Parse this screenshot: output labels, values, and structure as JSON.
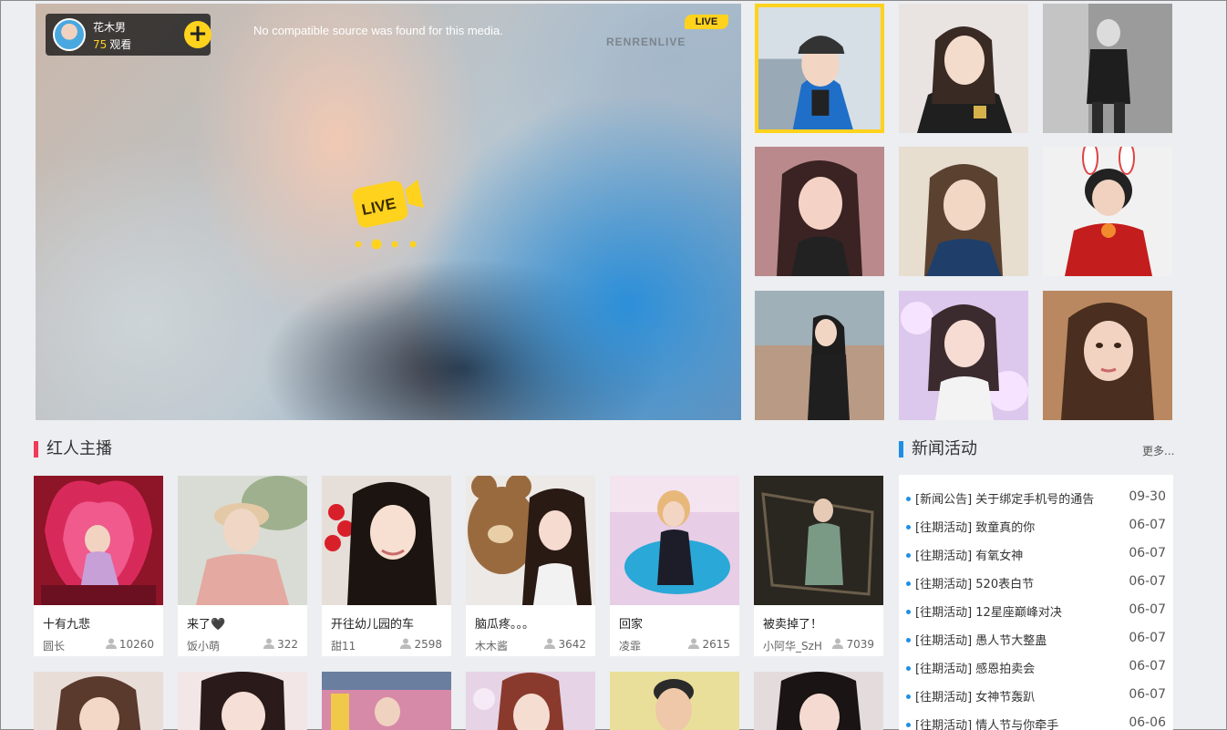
{
  "player": {
    "anchor_name": "花木男",
    "viewer_count": "75",
    "viewer_label": "观看",
    "follow_label": "+",
    "message": "No compatible source was found for this media.",
    "live_tag": "LIVE",
    "watermark": "RENRENLIVE",
    "badge_text": "LIVE"
  },
  "thumbs": [
    {
      "name": "featured-1",
      "active": true
    },
    {
      "name": "featured-2"
    },
    {
      "name": "featured-3"
    },
    {
      "name": "featured-4"
    },
    {
      "name": "featured-5"
    },
    {
      "name": "featured-6"
    },
    {
      "name": "featured-7"
    },
    {
      "name": "featured-8"
    },
    {
      "name": "featured-9"
    }
  ],
  "hot": {
    "title": "红人主播",
    "cards": [
      {
        "title": "十有九悲",
        "nick": "圆长",
        "count": "10260"
      },
      {
        "title": "来了🖤",
        "nick": "饭小萌",
        "count": "322"
      },
      {
        "title": "开往幼儿园的车",
        "nick": "甜11",
        "count": "2598"
      },
      {
        "title": "脑瓜疼。。。",
        "nick": "木木酱",
        "count": "3642"
      },
      {
        "title": "回家",
        "nick": "凌霏",
        "count": "2615"
      },
      {
        "title": "被卖掉了！",
        "nick": "小阿华_SzH",
        "count": "7039"
      }
    ]
  },
  "news": {
    "title": "新闻活动",
    "more": "更多...",
    "items": [
      {
        "text": "[新闻公告] 关于绑定手机号的通告",
        "date": "09-30"
      },
      {
        "text": "[往期活动] 致童真的你",
        "date": "06-07"
      },
      {
        "text": "[往期活动] 有氧女神",
        "date": "06-07"
      },
      {
        "text": "[往期活动] 520表白节",
        "date": "06-07"
      },
      {
        "text": "[往期活动] 12星座巅峰对决",
        "date": "06-07"
      },
      {
        "text": "[往期活动] 愚人节大整蛊",
        "date": "06-07"
      },
      {
        "text": "[往期活动] 感恩拍卖会",
        "date": "06-07"
      },
      {
        "text": "[往期活动] 女神节轰趴",
        "date": "06-07"
      },
      {
        "text": "[往期活动] 情人节与你牵手",
        "date": "06-06"
      }
    ]
  },
  "colors": {
    "accent_yellow": "#ffd21e",
    "accent_red": "#f03a5a",
    "accent_blue": "#1e8fe6"
  }
}
